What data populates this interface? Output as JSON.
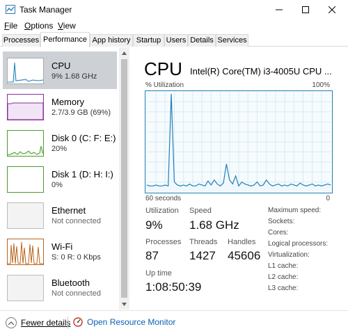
{
  "window": {
    "title": "Task Manager",
    "icon": "task-manager-icon",
    "controls": [
      "minimize-icon",
      "maximize-icon",
      "close-icon"
    ]
  },
  "menu": [
    {
      "label": "File",
      "underline": "F"
    },
    {
      "label": "Options",
      "underline": "O"
    },
    {
      "label": "View",
      "underline": "V"
    }
  ],
  "tabs": [
    "Processes",
    "Performance",
    "App history",
    "Startup",
    "Users",
    "Details",
    "Services"
  ],
  "active_tab": "Performance",
  "sidebar": [
    {
      "title": "CPU",
      "sub": "9% 1.68 GHz",
      "color": "#1e7eb8",
      "selected": true
    },
    {
      "title": "Memory",
      "sub": "2.7/3.9 GB (69%)",
      "color": "#8b2c9e"
    },
    {
      "title": "Disk 0 (C: F: E:)",
      "sub": "20%",
      "color": "#4c9a2a"
    },
    {
      "title": "Disk 1 (D: H: I:)",
      "sub": "0%",
      "color": "#4c9a2a"
    },
    {
      "title": "Ethernet",
      "sub": "Not connected",
      "color": "#bbbbbb"
    },
    {
      "title": "Wi-Fi",
      "sub": "S: 0 R: 0 Kbps",
      "color": "#b8641c"
    },
    {
      "title": "Bluetooth",
      "sub": "Not connected",
      "color": "#bbbbbb"
    }
  ],
  "main": {
    "title": "CPU",
    "model": "Intel(R) Core(TM) i3-4005U CPU ...",
    "util_label": "% Utilization",
    "util_max": "100%",
    "axis_left": "60 seconds",
    "axis_right": "0",
    "graph_color": "#1e7eb8",
    "stats": {
      "utilization_label": "Utilization",
      "utilization": "9%",
      "speed_label": "Speed",
      "speed": "1.68 GHz",
      "processes_label": "Processes",
      "processes": "87",
      "threads_label": "Threads",
      "threads": "1427",
      "handles_label": "Handles",
      "handles": "45606",
      "uptime_label": "Up time",
      "uptime": "1:08:50:39"
    },
    "specs": [
      "Maximum speed:",
      "Sockets:",
      "Cores:",
      "Logical processors:",
      "Virtualization:",
      "L1 cache:",
      "L2 cache:",
      "L3 cache:"
    ]
  },
  "footer": {
    "fewer_details": "Fewer details",
    "open_resource_monitor": "Open Resource Monitor"
  },
  "chart_data": {
    "type": "line",
    "xlabel": "60 seconds",
    "ylabel": "% Utilization",
    "ylim": [
      0,
      100
    ],
    "xlim": [
      0,
      60
    ],
    "grid": true,
    "x": [
      0,
      1,
      2,
      3,
      4,
      5,
      6,
      7,
      8,
      9,
      10,
      11,
      12,
      13,
      14,
      15,
      16,
      17,
      18,
      19,
      20,
      21,
      22,
      23,
      24,
      25,
      26,
      27,
      28,
      29,
      30,
      31,
      32,
      33,
      34,
      35,
      36,
      37,
      38,
      39,
      40,
      41,
      42,
      43,
      44,
      45,
      46,
      47,
      48,
      49,
      50,
      51,
      52,
      53,
      54,
      55,
      56,
      57,
      58,
      59,
      60
    ],
    "values": [
      7,
      6,
      6,
      7,
      6,
      6,
      7,
      6,
      98,
      10,
      7,
      6,
      7,
      6,
      8,
      6,
      6,
      8,
      7,
      6,
      11,
      7,
      12,
      8,
      6,
      9,
      28,
      12,
      8,
      16,
      6,
      10,
      8,
      7,
      6,
      7,
      10,
      6,
      7,
      12,
      8,
      6,
      7,
      8,
      6,
      7,
      6,
      8,
      7,
      6,
      9,
      7,
      6,
      7,
      8,
      6,
      7,
      6,
      7,
      8,
      7
    ]
  }
}
